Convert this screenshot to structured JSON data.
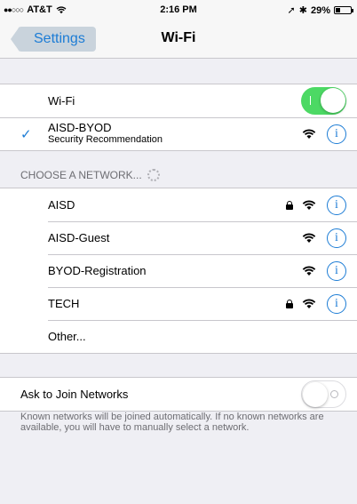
{
  "status": {
    "carrier": "AT&T",
    "signal": "●●○○○",
    "time": "2:16 PM",
    "battery": "29%",
    "battery_level": 0.29
  },
  "nav": {
    "back_label": "Settings",
    "title": "Wi-Fi"
  },
  "wifi": {
    "toggle_label": "Wi-Fi",
    "enabled": true,
    "connected": {
      "name": "AISD-BYOD",
      "subtitle": "Security Recommendation"
    }
  },
  "networks": {
    "header": "CHOOSE A NETWORK...",
    "items": [
      {
        "name": "AISD",
        "locked": true
      },
      {
        "name": "AISD-Guest",
        "locked": false
      },
      {
        "name": "BYOD-Registration",
        "locked": false
      },
      {
        "name": "TECH",
        "locked": true
      }
    ],
    "other_label": "Other..."
  },
  "ask": {
    "label": "Ask to Join Networks",
    "enabled": false,
    "footer": "Known networks will be joined automatically. If no known networks are available, you will have to manually select a network."
  },
  "icons": {
    "info": "i"
  },
  "colors": {
    "accent": "#1c7cd5",
    "toggle_on": "#4cd964"
  }
}
